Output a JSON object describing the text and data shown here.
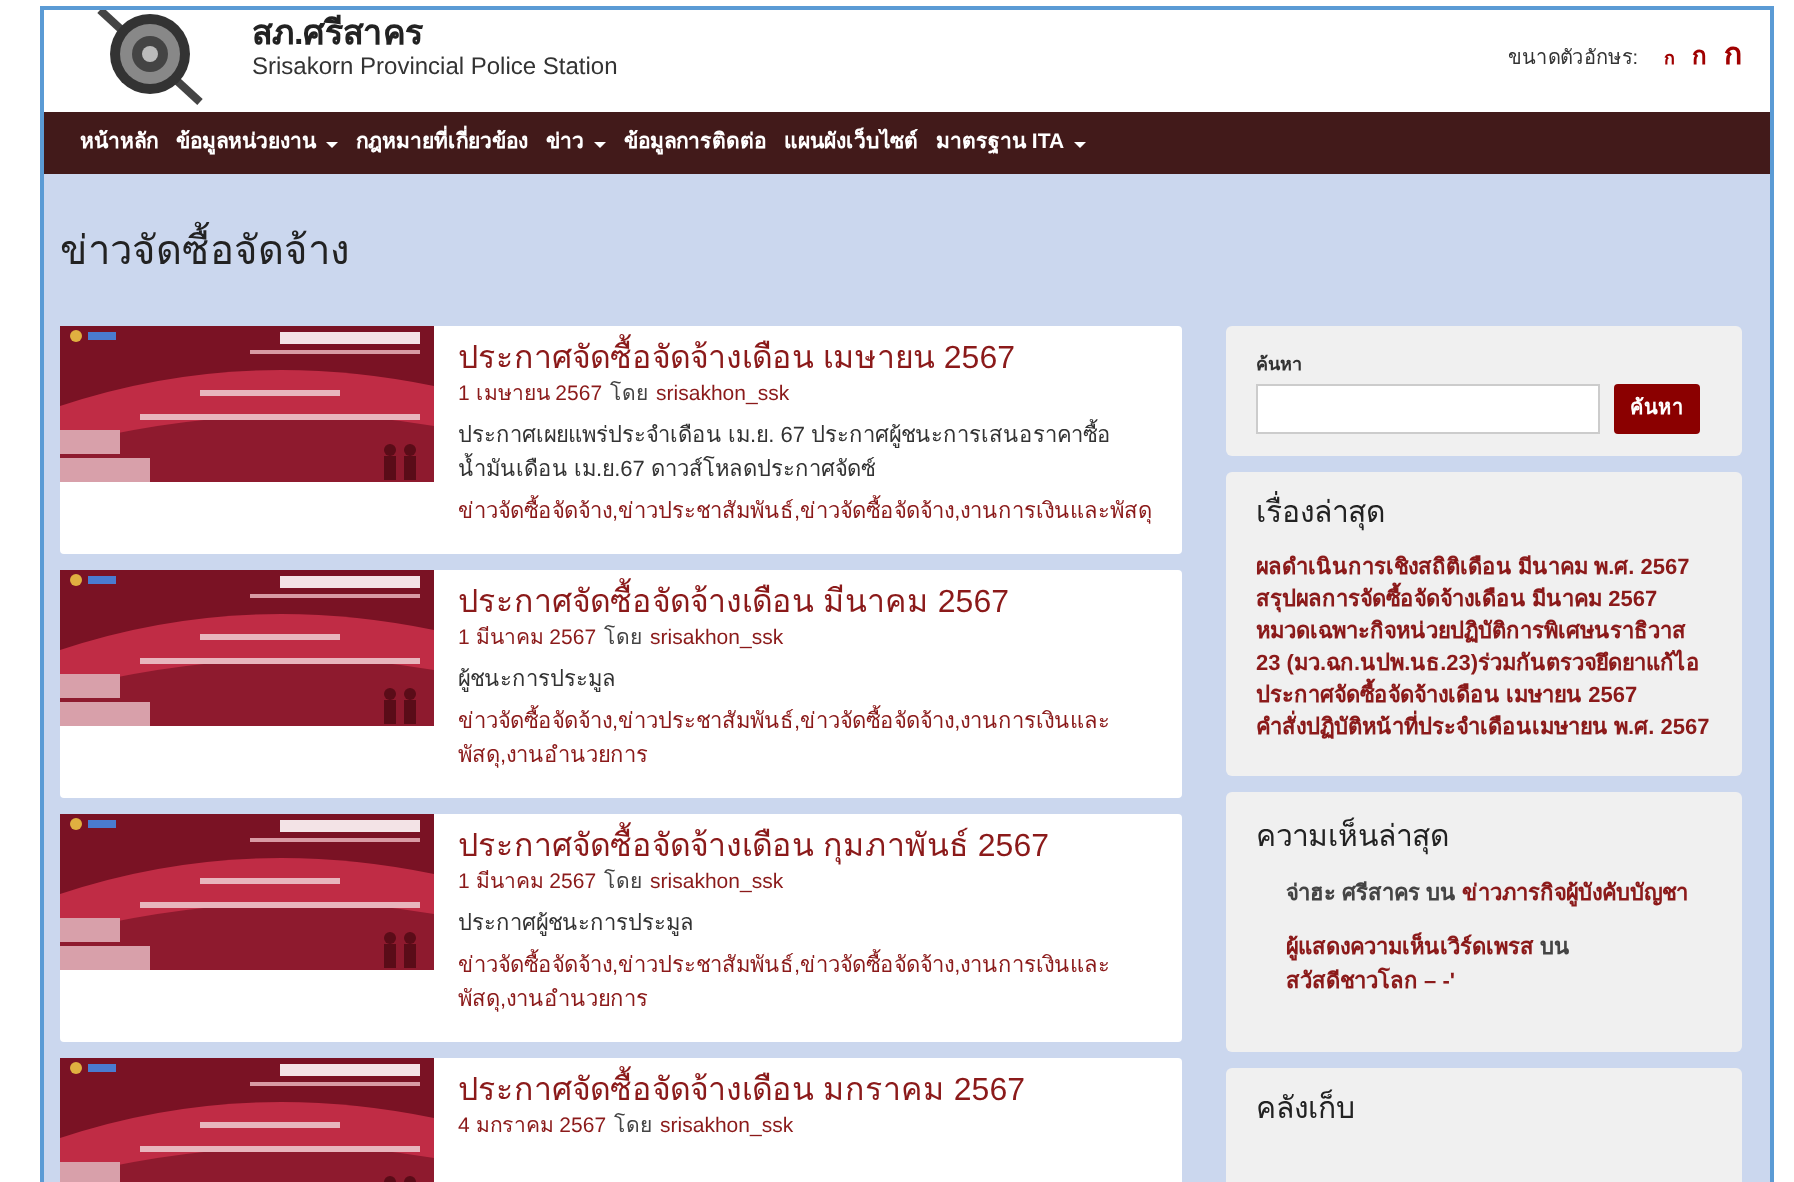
{
  "header": {
    "site_title": "สภ.ศรีสาคร",
    "site_subtitle": "Srisakorn Provincial Police Station",
    "font_size_label": "ขนาดตัวอักษร:",
    "font_sizes": [
      {
        "label": "ก",
        "kind": "small"
      },
      {
        "label": "ก",
        "kind": "medium"
      },
      {
        "label": "ก",
        "kind": "large"
      }
    ]
  },
  "nav": [
    {
      "label": "หน้าหลัก",
      "dropdown": false
    },
    {
      "label": "ข้อมูลหน่วยงาน",
      "dropdown": true
    },
    {
      "label": "กฎหมายที่เกี่ยวข้อง",
      "dropdown": false
    },
    {
      "label": "ข่าว",
      "dropdown": true
    },
    {
      "label": "ข้อมูลการติดต่อ",
      "dropdown": false
    },
    {
      "label": "แผนผังเว็บไซต์",
      "dropdown": false
    },
    {
      "label": "มาตรฐาน ITA",
      "dropdown": true
    }
  ],
  "page_title": "ข่าวจัดซื้อจัดจ้าง",
  "posts": [
    {
      "title": "ประกาศจัดซื้อจัดจ้างเดือน เมษายน 2567",
      "date": "1 เมษายน 2567",
      "by": "โดย",
      "author": "srisakhon_ssk",
      "excerpt": "ประกาศเผยแพร่ประจำเดือน เม.ย. 67 ประกาศผู้ชนะการเสนอราคาซื้อน้ำมันเดือน เม.ย.67 ดาวส์โหลดประกาศจัดซ์",
      "categories": "ข่าวจัดซื้อจัดจ้าง,ข่าวประชาสัมพันธ์,ข่าวจัดซื้อจัดจ้าง,งานการเงินและพัสดุ"
    },
    {
      "title": "ประกาศจัดซื้อจัดจ้างเดือน มีนาคม 2567",
      "date": "1 มีนาคม 2567",
      "by": "โดย",
      "author": "srisakhon_ssk",
      "excerpt": "ผู้ชนะการประมูล",
      "categories": "ข่าวจัดซื้อจัดจ้าง,ข่าวประชาสัมพันธ์,ข่าวจัดซื้อจัดจ้าง,งานการเงินและพัสดุ,งานอำนวยการ"
    },
    {
      "title": "ประกาศจัดซื้อจัดจ้างเดือน กุมภาพันธ์ 2567",
      "date": "1 มีนาคม 2567",
      "by": "โดย",
      "author": "srisakhon_ssk",
      "excerpt": "ประกาศผู้ชนะการประมูล",
      "categories": "ข่าวจัดซื้อจัดจ้าง,ข่าวประชาสัมพันธ์,ข่าวจัดซื้อจัดจ้าง,งานการเงินและพัสดุ,งานอำนวยการ"
    },
    {
      "title": "ประกาศจัดซื้อจัดจ้างเดือน มกราคม 2567",
      "date": "4 มกราคม 2567",
      "by": "โดย",
      "author": "srisakhon_ssk"
    }
  ],
  "search": {
    "label": "ค้นหา",
    "button": "ค้นหา"
  },
  "recent_posts": {
    "heading": "เรื่องล่าสุด",
    "items": [
      "ผลดำเนินการเชิงสถิติเดือน มีนาคม พ.ศ. 2567",
      "สรุปผลการจัดซื้อจัดจ้างเดือน มีนาคม 2567",
      "หมวดเฉพาะกิจหน่วยปฏิบัติการพิเศษนราธิวาส 23 (มว.ฉก.นปพ.นธ.23)ร่วมกันตรวจยึดยาแก้ไอ",
      "ประกาศจัดซื้อจัดจ้างเดือน เมษายน 2567",
      "คำสั่งปฏิบัติหน้าที่ประจำเดือนเมษายน พ.ศ. 2567"
    ]
  },
  "recent_comments": {
    "heading": "ความเห็นล่าสุด",
    "items": [
      {
        "author": "จ่าฮะ ศรีสาคร",
        "author_link": false,
        "on": "บน",
        "post": "ข่าวภารกิจผู้บังคับบัญชา"
      },
      {
        "author": "ผู้แสดงความเห็นเวิร์ดเพรส",
        "author_link": true,
        "on": "บน",
        "post": "สวัสดีชาวโลก – -'"
      }
    ]
  },
  "archives": {
    "heading": "คลังเก็บ"
  }
}
